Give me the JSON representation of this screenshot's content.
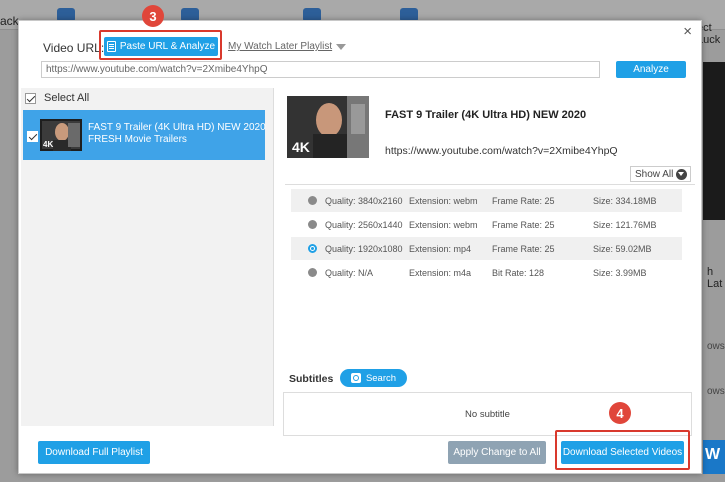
{
  "background": {
    "back_label": "ack",
    "right_top_label": "ect Luck",
    "side_label_1": "h Lat",
    "side_label_2": "owse",
    "side_label_3": "owse",
    "big_button_label": "W"
  },
  "dialog": {
    "close_label": "×",
    "video_url_label": "Video URL:",
    "paste_button_label": "Paste URL & Analyze",
    "watch_later_label": "My Watch Later Playlist",
    "url_value": "https://www.youtube.com/watch?v=2Xmibe4YhpQ",
    "analyze_label": "Analyze",
    "step3_marker": "3",
    "step4_marker": "4"
  },
  "left_panel": {
    "select_all_label": "Select All",
    "select_all_checked": true,
    "items": [
      {
        "title": "FAST 9 Trailer (4K Ultra HD) NEW 2020",
        "channel": "FRESH Movie Trailers",
        "checked": true,
        "thumb_badge": "4K"
      }
    ]
  },
  "detail": {
    "title": "FAST 9 Trailer (4K Ultra HD) NEW 2020",
    "url": "https://www.youtube.com/watch?v=2Xmibe4YhpQ",
    "thumb_badge": "4K",
    "show_all_label": "Show All",
    "qualities": [
      {
        "quality": "Quality: 3840x2160",
        "extension": "Extension: webm",
        "rate": "Frame Rate: 25",
        "size": "Size: 334.18MB",
        "selected": false
      },
      {
        "quality": "Quality: 2560x1440",
        "extension": "Extension: webm",
        "rate": "Frame Rate: 25",
        "size": "Size: 121.76MB",
        "selected": false
      },
      {
        "quality": "Quality: 1920x1080",
        "extension": "Extension: mp4",
        "rate": "Frame Rate: 25",
        "size": "Size: 59.02MB",
        "selected": true
      },
      {
        "quality": "Quality: N/A",
        "extension": "Extension: m4a",
        "rate": "Bit Rate: 128",
        "size": "Size: 3.99MB",
        "selected": false
      }
    ],
    "subtitles_label": "Subtitles",
    "subtitles_search_label": "Search",
    "no_subtitle_label": "No subtitle"
  },
  "footer": {
    "download_playlist_label": "Download Full Playlist",
    "apply_change_label": "Apply Change to All",
    "download_selected_label": "Download Selected Videos"
  },
  "colors": {
    "accent": "#1fa0e6",
    "selected_item": "#3fa3e8",
    "highlight_box": "#d9392d",
    "disabled_button": "#8fa3b3"
  }
}
